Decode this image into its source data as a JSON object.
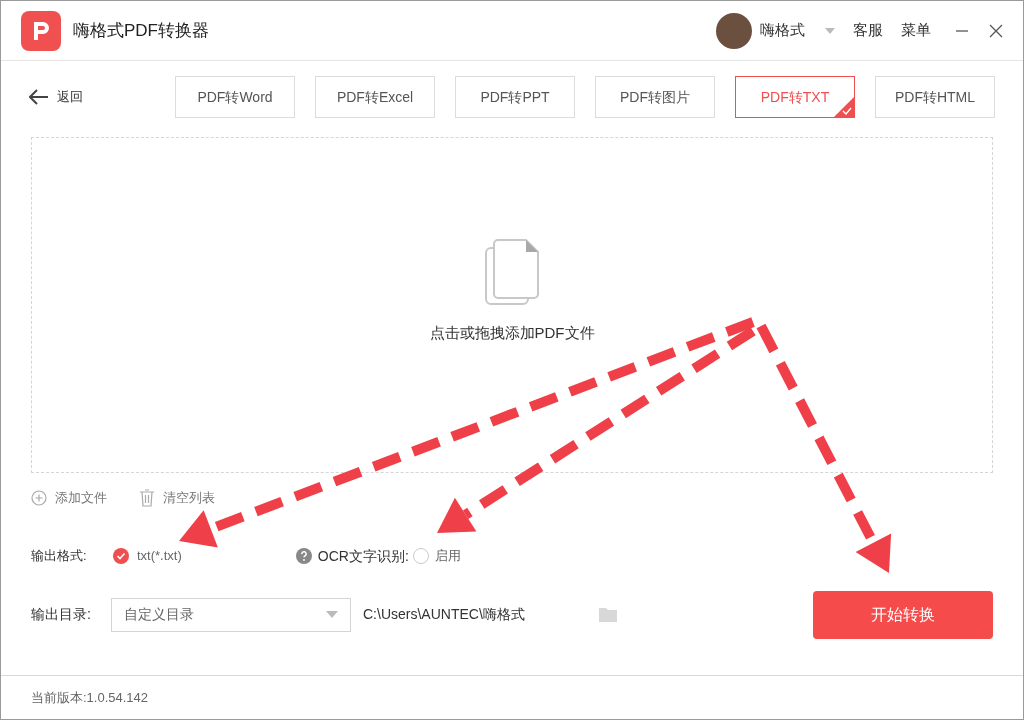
{
  "app": {
    "title": "嗨格式PDF转换器",
    "user": "嗨格式",
    "links": [
      "客服",
      "菜单"
    ]
  },
  "back": "返回",
  "tabs": [
    {
      "label": "PDF转Word",
      "selected": false
    },
    {
      "label": "PDF转Excel",
      "selected": false
    },
    {
      "label": "PDF转PPT",
      "selected": false
    },
    {
      "label": "PDF转图片",
      "selected": false
    },
    {
      "label": "PDF转TXT",
      "selected": true
    },
    {
      "label": "PDF转HTML",
      "selected": false
    }
  ],
  "drop_hint": "点击或拖拽添加PDF文件",
  "tools": [
    {
      "kind": "add",
      "label": "添加文件"
    },
    {
      "kind": "clear",
      "label": "清空列表"
    }
  ],
  "format": {
    "label": "输出格式:",
    "option": "txt(*.txt)",
    "checked": true
  },
  "ocr": {
    "label": "OCR文字识别:",
    "option": "启用",
    "checked": false
  },
  "output": {
    "label": "输出目录:",
    "select": "自定义目录",
    "path": "C:\\Users\\AUNTEC\\嗨格式"
  },
  "start_button": "开始转换",
  "version": "当前版本:1.0.54.142"
}
